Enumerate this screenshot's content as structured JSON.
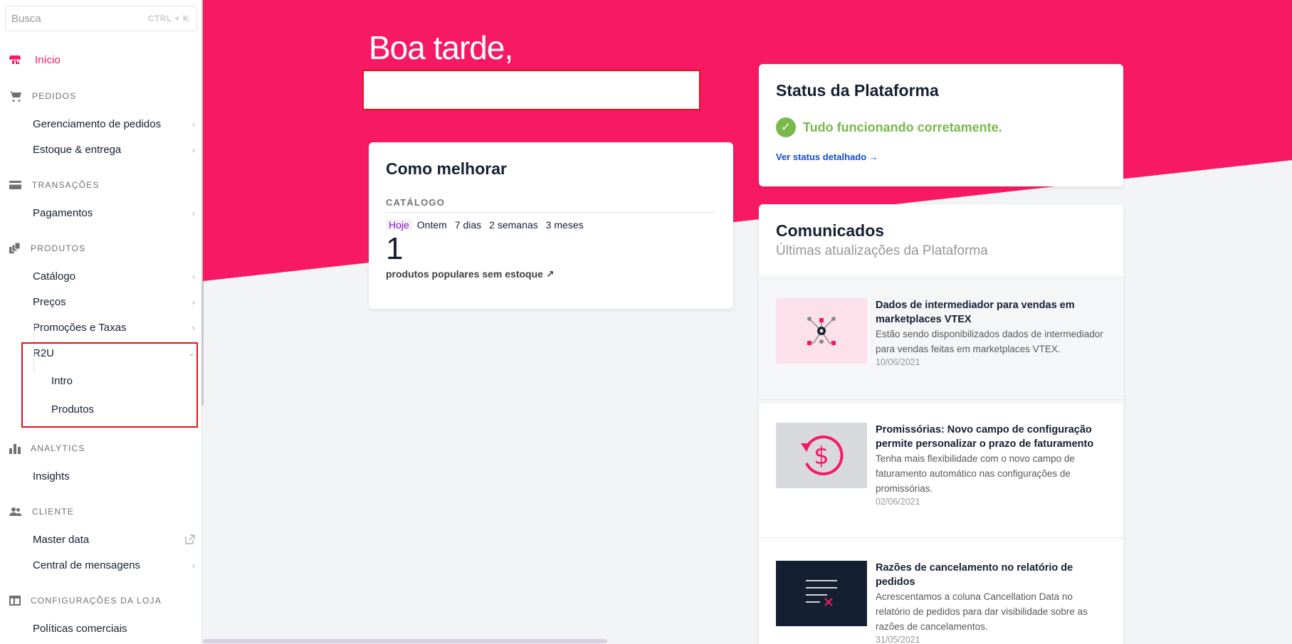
{
  "search": {
    "placeholder": "Busca",
    "shortcut": "CTRL + K"
  },
  "sidebar": {
    "home_label": "Início",
    "sections": {
      "pedidos": "PEDIDOS",
      "transacoes": "TRANSAÇÕES",
      "produtos": "PRODUTOS",
      "analytics": "ANALYTICS",
      "cliente": "CLIENTE",
      "config": "CONFIGURAÇÕES DA LOJA"
    },
    "items": {
      "gerenciamento": "Gerenciamento de pedidos",
      "estoque": "Estoque & entrega",
      "pagamentos": "Pagamentos",
      "catalogo": "Catálogo",
      "precos": "Preços",
      "promocoes": "Promoções e Taxas",
      "r2u": "R2U",
      "intro": "Intro",
      "produtos": "Produtos",
      "insights": "Insights",
      "master_data": "Master data",
      "central": "Central de mensagens",
      "politicas": "Políticas comerciais"
    }
  },
  "main": {
    "greeting": "Boa tarde,",
    "melhorar": {
      "title": "Como melhorar",
      "section": "CATÁLOGO",
      "tabs": [
        "Hoje",
        "Ontem",
        "7 dias",
        "2 semanas",
        "3 meses"
      ],
      "count": "1",
      "link": "produtos populares sem estoque ↗"
    },
    "status": {
      "title": "Status da Plataforma",
      "ok_text": "Tudo funcionando corretamente.",
      "link": "Ver status detalhado →"
    },
    "comunicados": {
      "title": "Comunicados",
      "subtitle": "Últimas atualizações da Plataforma",
      "news": [
        {
          "title": "Dados de intermediador para vendas em marketplaces VTEX",
          "desc": "Estão sendo disponibilizados dados de intermediador para vendas feitas em marketplaces VTEX.",
          "date": "10/06/2021"
        },
        {
          "title": "Promissórias: Novo campo de configuração permite personalizar o prazo de faturamento",
          "desc": "Tenha mais flexibilidade com o novo campo de faturamento automático nas configurações de promissórias.",
          "date": "02/06/2021"
        },
        {
          "title": "Razões de cancelamento no relatório de pedidos",
          "desc": "Acrescentamos a coluna Cancellation Data no relatório de pedidos para dar visibilidade sobre as razões de cancelamentos.",
          "date": "31/05/2021"
        }
      ]
    }
  },
  "colors": {
    "brand": "#f71963",
    "ok": "#79b84a",
    "link": "#134cd8"
  }
}
